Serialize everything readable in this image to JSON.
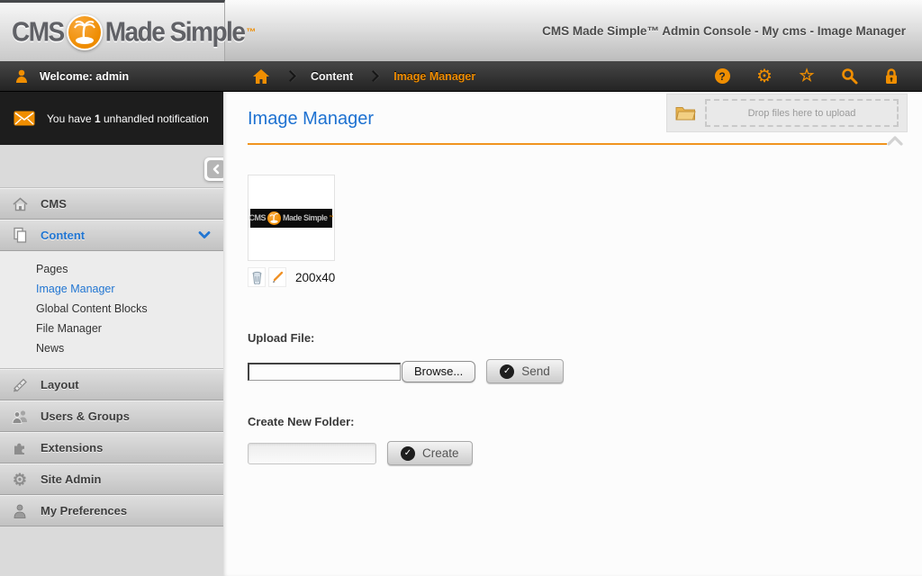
{
  "header": {
    "window_title": "CMS Made Simple™ Admin Console - My cms - Image Manager",
    "logo": {
      "part1": "CMS",
      "part2": "Made Simple",
      "tm": "™"
    }
  },
  "topbar": {
    "welcome": "Welcome: admin",
    "breadcrumb": {
      "level1": "Content",
      "level2": "Image Manager"
    }
  },
  "notification": {
    "prefix": "You have",
    "count": "1",
    "suffix": "unhandled notification"
  },
  "sidebar": {
    "sections": [
      {
        "label": "CMS"
      },
      {
        "label": "Content"
      },
      {
        "label": "Layout"
      },
      {
        "label": "Users & Groups"
      },
      {
        "label": "Extensions"
      },
      {
        "label": "Site Admin"
      },
      {
        "label": "My Preferences"
      }
    ],
    "content_submenu": [
      {
        "label": "Pages"
      },
      {
        "label": "Image Manager"
      },
      {
        "label": "Global Content Blocks"
      },
      {
        "label": "File Manager"
      },
      {
        "label": "News"
      }
    ]
  },
  "main": {
    "title": "Image Manager",
    "dropzone_label": "Drop files here to upload",
    "thumbnail": {
      "dimensions": "200x40",
      "logo_text1": "CMS",
      "logo_text2": "Made Simple",
      "logo_tm": "™"
    },
    "upload_file": {
      "label": "Upload File:",
      "browse_button": "Browse...",
      "send_button": "Send"
    },
    "create_folder": {
      "label": "Create New Folder:",
      "create_button": "Create"
    }
  },
  "glyphs": {
    "help": "?",
    "gear": "⚙",
    "star": "☆",
    "check": "✓"
  },
  "colors": {
    "accent_orange": "#ef8c00",
    "link_blue": "#2276d2",
    "rule_orange": "#f0941f"
  }
}
